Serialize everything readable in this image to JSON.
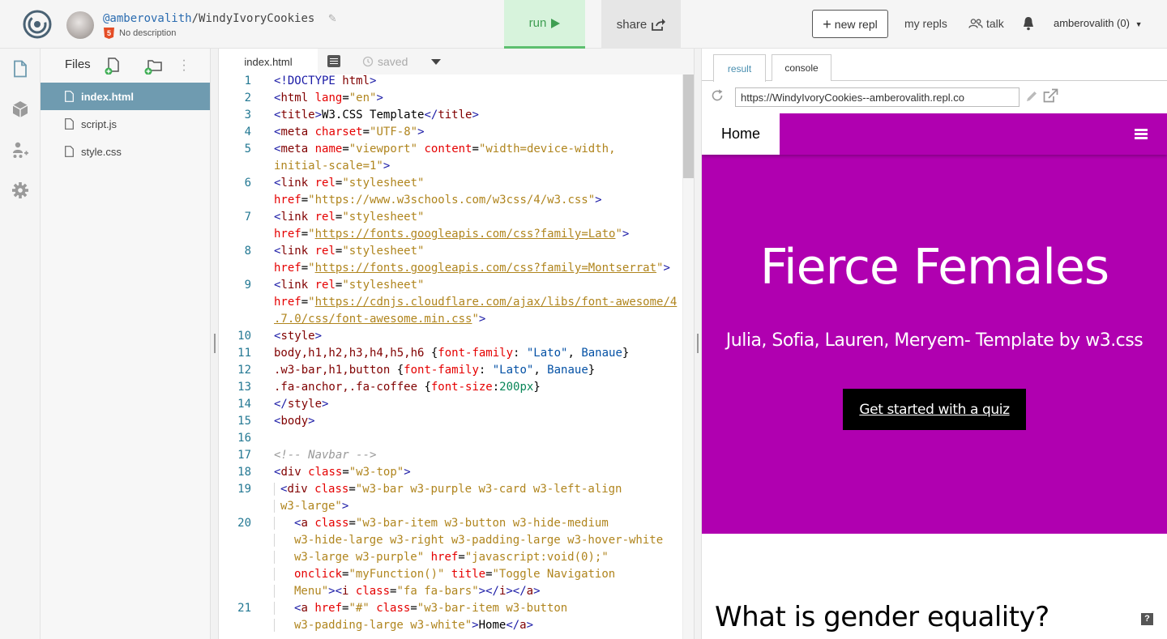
{
  "header": {
    "username": "@amberovalith",
    "separator": "/",
    "repl_name": "WindyIvoryCookies",
    "description": "No description",
    "run_label": "run",
    "share_label": "share",
    "new_repl_label": "new repl",
    "my_repls_label": "my repls",
    "talk_label": "talk",
    "user_menu_label": "amberovalith (0)"
  },
  "sidebar": {
    "title": "Files",
    "files": [
      {
        "name": "index.html",
        "active": true
      },
      {
        "name": "script.js",
        "active": false
      },
      {
        "name": "style.css",
        "active": false
      }
    ]
  },
  "editor": {
    "tab_label": "index.html",
    "saved_label": "saved",
    "line_numbers": [
      "1",
      "2",
      "3",
      "4",
      "5",
      "6",
      "7",
      "8",
      "9",
      "10",
      "11",
      "12",
      "13",
      "14",
      "15",
      "16",
      "17",
      "18",
      "19",
      "20",
      "21"
    ]
  },
  "preview": {
    "tabs": [
      "result",
      "console"
    ],
    "url": "https://WindyIvoryCookies--amberovalith.repl.co",
    "nav_home": "Home",
    "hero_title": "Fierce Females",
    "hero_subtitle": "Julia, Sofia, Lauren, Meryem- Template by w3.css",
    "cta_label": "Get started with a quiz",
    "section_title": "What is gender equality?",
    "help_label": "?"
  },
  "colors": {
    "accent_purple": "#b000b0",
    "run_green": "#3f9e52",
    "active_file": "#6f9bb0"
  }
}
